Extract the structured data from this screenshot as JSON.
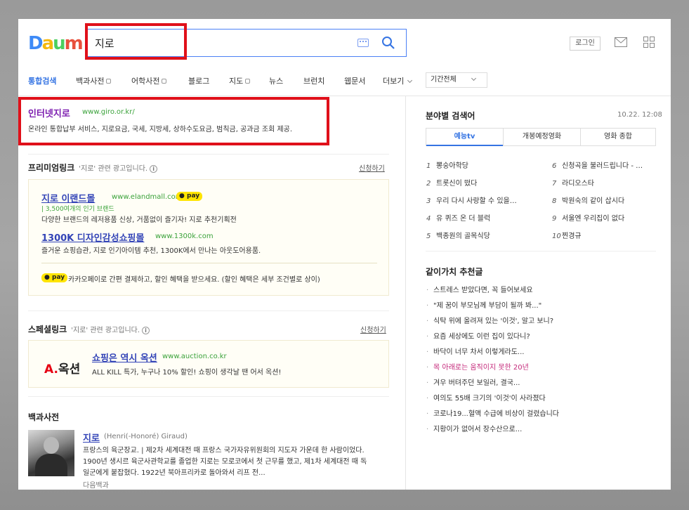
{
  "search": {
    "query": "지로"
  },
  "header": {
    "login_label": "로그인"
  },
  "nav": {
    "items": [
      "통합검색",
      "백과사전",
      "어학사전",
      "블로그",
      "지도",
      "뉴스",
      "브런치",
      "웹문서",
      "더보기"
    ],
    "date_filter": "기간전체"
  },
  "result1": {
    "title": "인터넷지로",
    "url": "www.giro.or.kr/",
    "desc": "온라인 통합납부 서비스, 지로요금, 국세, 지방세, 상하수도요금, 범칙금, 공과금 조회 제공."
  },
  "premium": {
    "title": "프리미엄링크",
    "sub_prefix": "'지로' 관련 광고입니다.",
    "apply": "신청하기",
    "ads": [
      {
        "title": "지로 이랜드몰",
        "url": "www.elandmall.com",
        "badge": "pay",
        "tagline": "3,500여개의 인기 브랜드",
        "desc": "다양한 브랜드의 레저용품 신상, 거품없이 즐기자! 지로 추천기획전"
      },
      {
        "title": "1300K 디자인감성쇼핑몰",
        "url": "www.1300k.com",
        "desc": "즐거운 쇼핑습관, 지로 인기아이템 추천, 1300K에서 만나는 아웃도어용품."
      }
    ],
    "pay_badge": "pay",
    "pay_note": "카카오페이로 간편 결제하고, 할인 혜택을 받으세요. (할인 혜택은 세부 조건별로 상이)"
  },
  "special": {
    "title": "스페셜링크",
    "sub_prefix": "'지로' 관련 광고입니다.",
    "apply": "신청하기",
    "logo_a": "A.",
    "logo_text": "옥션",
    "ad_title": "쇼핑은 역시 옥션",
    "ad_url": "www.auction.co.kr",
    "ad_desc": "ALL KILL 특가, 누구나 10% 할인! 쇼핑이 생각날 땐 어서 옥션!"
  },
  "encyclopedia": {
    "section_title": "백과사전",
    "title": "지로",
    "meta": "(Henri(-Honoré) Giraud)",
    "lines": [
      "프랑스의 육군장교. | 제2차 세계대전 때 프랑스 국가자유위원회의 지도자 가운데 한 사람이었다.",
      "1900년 생시르 육군사관학교를 졸업한 지로는 모로코에서 첫 근무를 했고, 제1차 세계대전 때 독",
      "일군에게 붙잡혔다. 1922년 북아프리카로 돌아와서 리프 전..."
    ],
    "source": "다음백과"
  },
  "trending": {
    "title": "분야별 검색어",
    "time": "10.22. 12:08",
    "tabs": [
      "예능tv",
      "개봉예정영화",
      "영화 종합"
    ],
    "keywords": [
      {
        "rank": "1",
        "text": "뽕숭아학당"
      },
      {
        "rank": "2",
        "text": "트롯신이 떴다"
      },
      {
        "rank": "3",
        "text": "우리 다시 사랑할 수 있을…"
      },
      {
        "rank": "4",
        "text": "유 퀴즈 온 더 블럭"
      },
      {
        "rank": "5",
        "text": "백종원의 골목식당"
      },
      {
        "rank": "6",
        "text": "신청곡을 불러드립니다 - …"
      },
      {
        "rank": "7",
        "text": "라디오스타"
      },
      {
        "rank": "8",
        "text": "박원숙의 같이 삽시다"
      },
      {
        "rank": "9",
        "text": "서울엔 우리집이 없다"
      },
      {
        "rank": "10",
        "text": "찐경규"
      }
    ]
  },
  "recommend": {
    "title": "같이가치 추천글",
    "items": [
      "스트레스 받았다면, 꼭 들어보세요",
      "\"제 꿈이 부모님께 부담이 될까 봐...\"",
      "식탁 위에 올려져 있는 '이것', 알고 보니?",
      "요즘 세상에도 이런 집이 있다니?",
      "바닥이 너무 차서 이렇게라도...",
      "목 아래로는 움직이지 못한 20년",
      "겨우 버텨주던 보일러, 결국...",
      "여의도 55배 크기의 '이것'이 사라졌다",
      "코로나19...혈액 수급에 비상이 걸렸습니다",
      "지황이가 없어서 장수산으로..."
    ]
  },
  "colors": {
    "accent": "#3574e3",
    "highlight_box": "#e0101a",
    "url_green": "#3aa23a",
    "visited": "#7d1fb0"
  }
}
